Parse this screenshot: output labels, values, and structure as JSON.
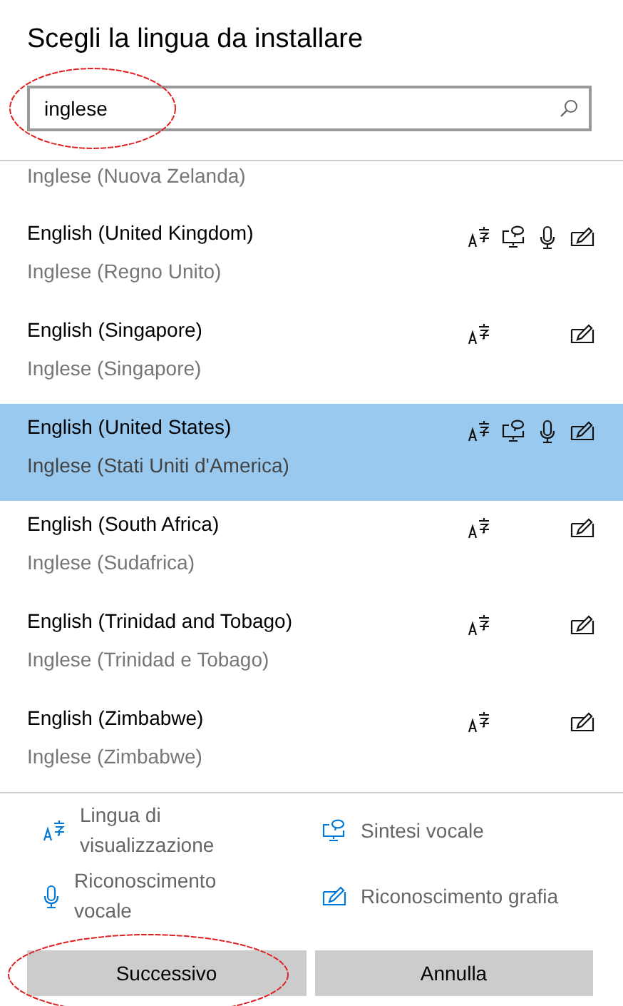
{
  "title": "Scegli la lingua da installare",
  "search": {
    "value": "inglese"
  },
  "partial_row": {
    "subtitle": "Inglese (Nuova Zelanda)"
  },
  "languages": [
    {
      "name": "English (United Kingdom)",
      "subtitle": "Inglese (Regno Unito)",
      "selected": false,
      "display": true,
      "speech": true,
      "voice": true,
      "handwriting": true
    },
    {
      "name": "English (Singapore)",
      "subtitle": "Inglese (Singapore)",
      "selected": false,
      "display": true,
      "speech": false,
      "voice": false,
      "handwriting": true
    },
    {
      "name": "English (United States)",
      "subtitle": "Inglese (Stati Uniti d'America)",
      "selected": true,
      "display": true,
      "speech": true,
      "voice": true,
      "handwriting": true
    },
    {
      "name": "English (South Africa)",
      "subtitle": "Inglese (Sudafrica)",
      "selected": false,
      "display": true,
      "speech": false,
      "voice": false,
      "handwriting": true
    },
    {
      "name": "English (Trinidad and Tobago)",
      "subtitle": "Inglese (Trinidad e Tobago)",
      "selected": false,
      "display": true,
      "speech": false,
      "voice": false,
      "handwriting": true
    },
    {
      "name": "English (Zimbabwe)",
      "subtitle": "Inglese (Zimbabwe)",
      "selected": false,
      "display": true,
      "speech": false,
      "voice": false,
      "handwriting": true
    }
  ],
  "legend": [
    {
      "kind": "display",
      "label": "Lingua di visualizzazione"
    },
    {
      "kind": "speech",
      "label": "Sintesi vocale"
    },
    {
      "kind": "voice",
      "label": "Riconoscimento vocale"
    },
    {
      "kind": "handwriting",
      "label": "Riconoscimento grafia"
    }
  ],
  "buttons": [
    "Successivo",
    "Annulla"
  ]
}
